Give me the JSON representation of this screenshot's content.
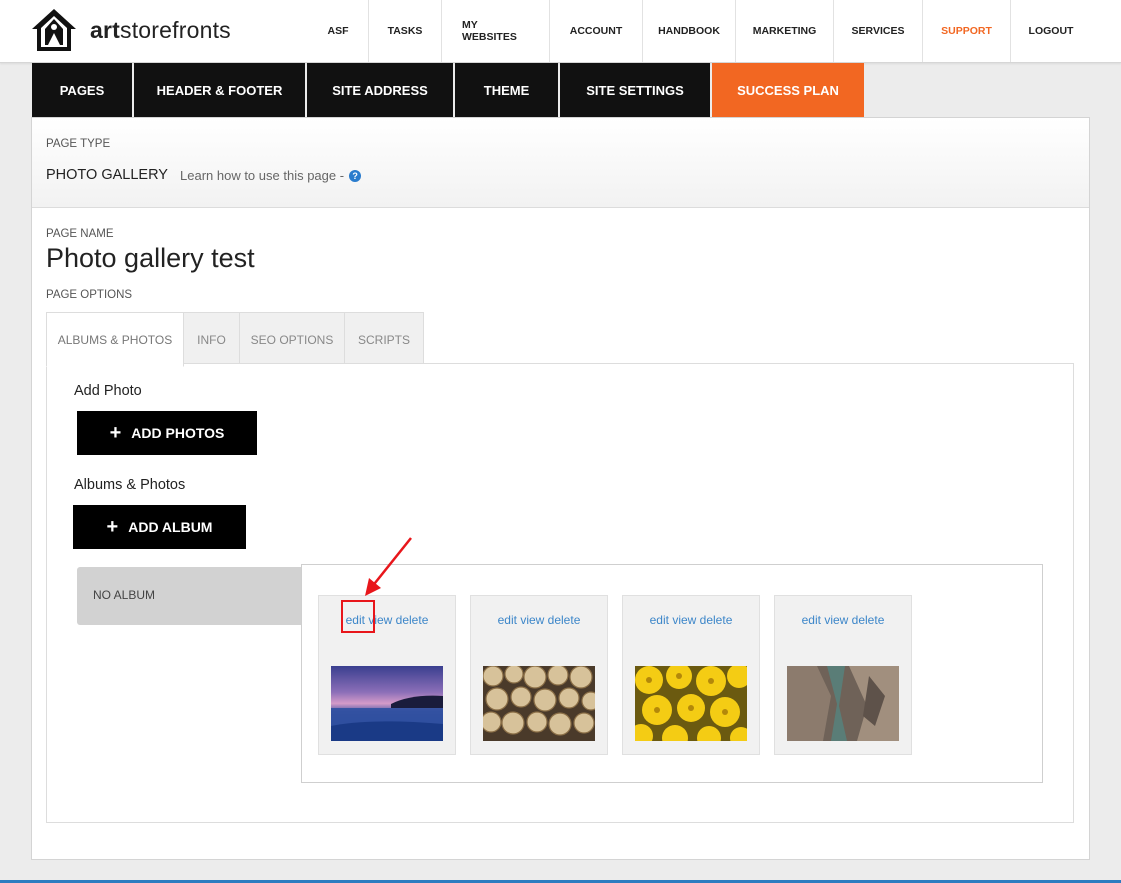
{
  "header": {
    "logo_bold": "art",
    "logo_rest": "storefronts",
    "nav": [
      "ASF",
      "TASKS",
      "MY WEBSITES",
      "ACCOUNT",
      "HANDBOOK",
      "MARKETING",
      "SERVICES",
      "SUPPORT",
      "LOGOUT"
    ]
  },
  "tabs": [
    "PAGES",
    "HEADER & FOOTER",
    "SITE ADDRESS",
    "THEME",
    "SITE SETTINGS",
    "SUCCESS PLAN"
  ],
  "page": {
    "type_label": "PAGE TYPE",
    "type_value": "PHOTO GALLERY",
    "learn_text": "Learn how to use this page -",
    "help_icon": "?",
    "name_label": "PAGE NAME",
    "name_value": "Photo gallery test",
    "options_label": "PAGE OPTIONS"
  },
  "inner_tabs": [
    "ALBUMS & PHOTOS",
    "INFO",
    "SEO OPTIONS",
    "SCRIPTS"
  ],
  "albums": {
    "add_photo_title": "Add Photo",
    "add_photos_button": "ADD PHOTOS",
    "albums_title": "Albums & Photos",
    "add_album_button": "ADD ALBUM",
    "plus_icon": "+",
    "no_album": "NO ALBUM",
    "photos": [
      {
        "edit": "edit",
        "view": "view",
        "delete": "delete",
        "image": "sunset-lake"
      },
      {
        "edit": "edit",
        "view": "view",
        "delete": "delete",
        "image": "firewood-logs"
      },
      {
        "edit": "edit",
        "view": "view",
        "delete": "delete",
        "image": "yellow-flowers"
      },
      {
        "edit": "edit",
        "view": "view",
        "delete": "delete",
        "image": "rock-canyon"
      }
    ]
  },
  "colors": {
    "accent": "#f26722",
    "tab_bg": "#111111",
    "link": "#3c86c9",
    "highlight": "#e8161b"
  }
}
